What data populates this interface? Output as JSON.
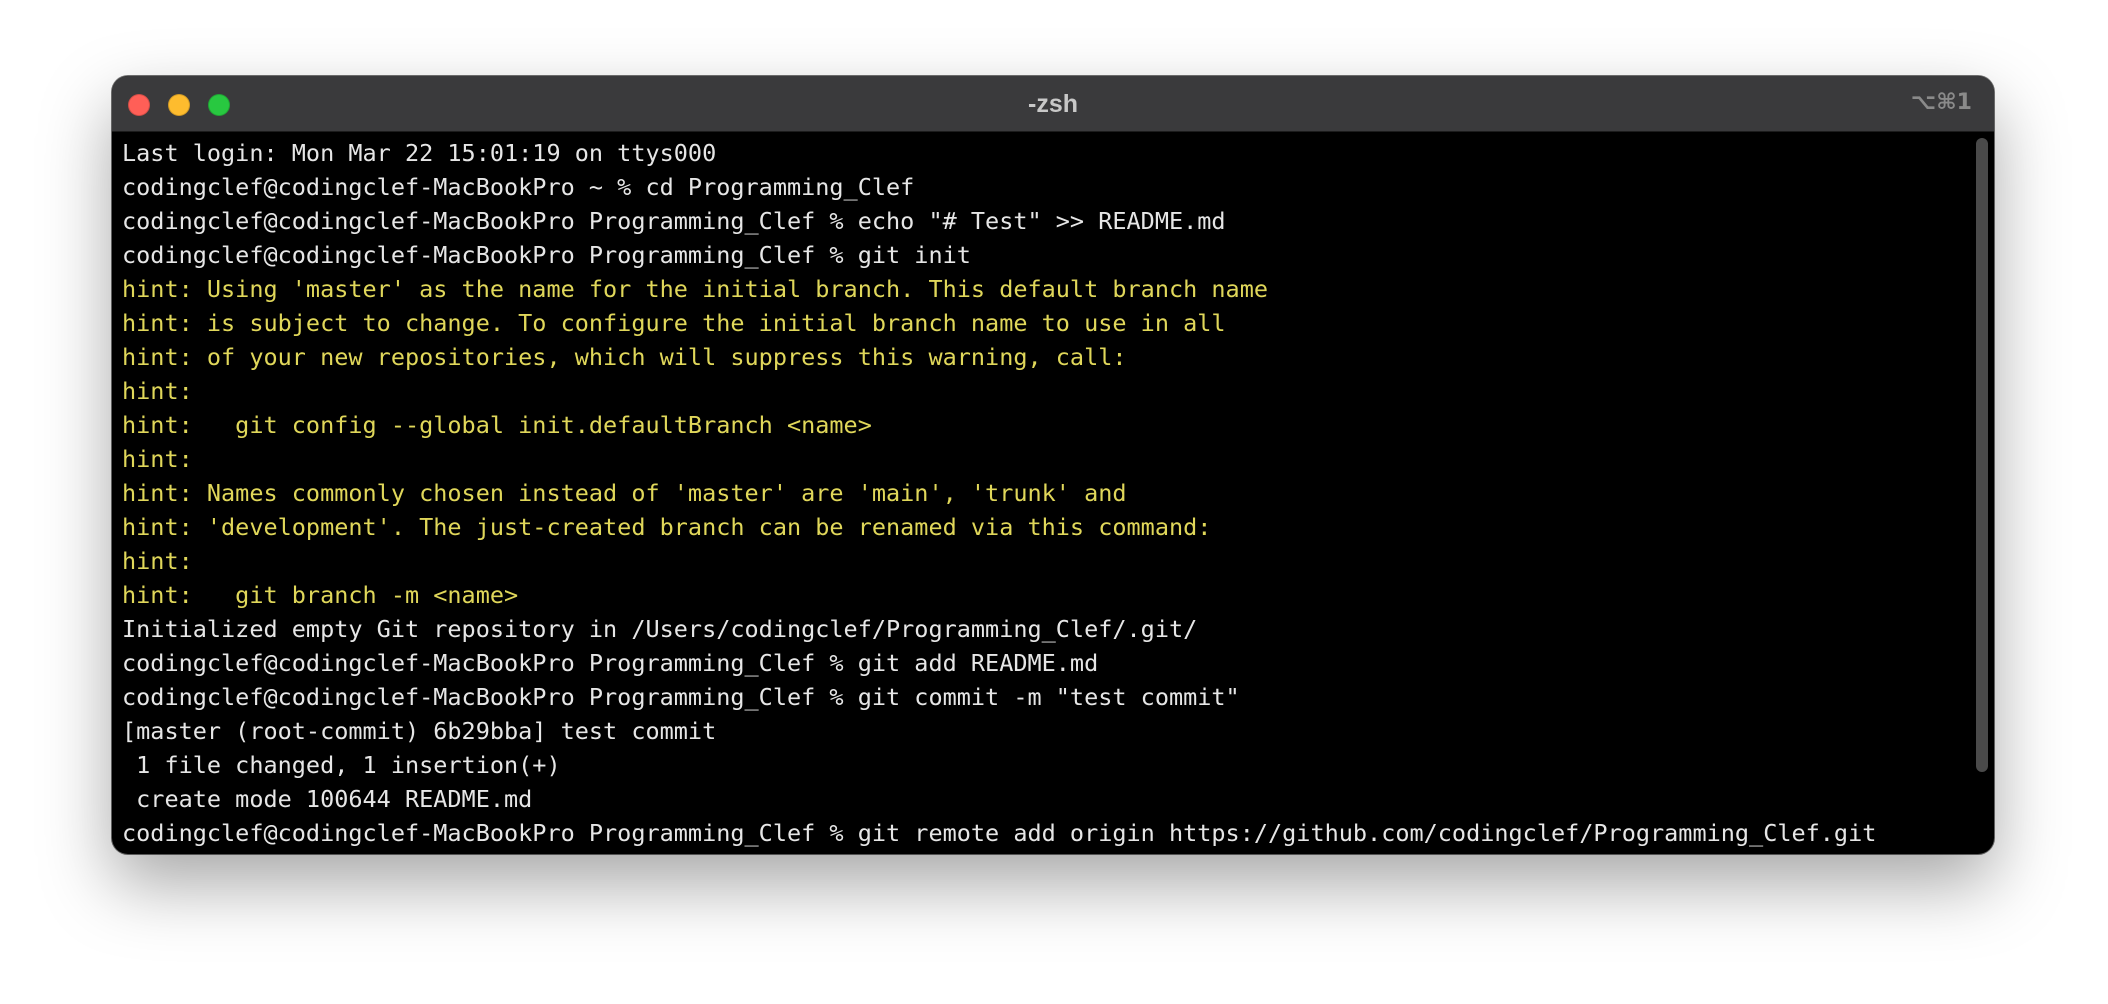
{
  "window": {
    "title": "-zsh",
    "shortcut": "⌥⌘1"
  },
  "terminal": {
    "lines": [
      {
        "text": "Last login: Mon Mar 22 15:01:19 on ttys000",
        "style": "normal"
      },
      {
        "text": "codingclef@codingclef-MacBookPro ~ % cd Programming_Clef",
        "style": "normal"
      },
      {
        "text": "codingclef@codingclef-MacBookPro Programming_Clef % echo \"# Test\" >> README.md",
        "style": "normal"
      },
      {
        "text": "codingclef@codingclef-MacBookPro Programming_Clef % git init",
        "style": "normal"
      },
      {
        "text": "hint: Using 'master' as the name for the initial branch. This default branch name",
        "style": "hint"
      },
      {
        "text": "hint: is subject to change. To configure the initial branch name to use in all",
        "style": "hint"
      },
      {
        "text": "hint: of your new repositories, which will suppress this warning, call:",
        "style": "hint"
      },
      {
        "text": "hint:",
        "style": "hint"
      },
      {
        "text": "hint:   git config --global init.defaultBranch <name>",
        "style": "hint"
      },
      {
        "text": "hint:",
        "style": "hint"
      },
      {
        "text": "hint: Names commonly chosen instead of 'master' are 'main', 'trunk' and",
        "style": "hint"
      },
      {
        "text": "hint: 'development'. The just-created branch can be renamed via this command:",
        "style": "hint"
      },
      {
        "text": "hint:",
        "style": "hint"
      },
      {
        "text": "hint:   git branch -m <name>",
        "style": "hint"
      },
      {
        "text": "Initialized empty Git repository in /Users/codingclef/Programming_Clef/.git/",
        "style": "normal"
      },
      {
        "text": "codingclef@codingclef-MacBookPro Programming_Clef % git add README.md",
        "style": "normal"
      },
      {
        "text": "codingclef@codingclef-MacBookPro Programming_Clef % git commit -m \"test commit\"",
        "style": "normal"
      },
      {
        "text": "[master (root-commit) 6b29bba] test commit",
        "style": "normal"
      },
      {
        "text": " 1 file changed, 1 insertion(+)",
        "style": "normal"
      },
      {
        "text": " create mode 100644 README.md",
        "style": "normal"
      },
      {
        "text": "codingclef@codingclef-MacBookPro Programming_Clef % git remote add origin https://github.com/codingclef/Programming_Clef.git",
        "style": "normal"
      }
    ]
  },
  "colors": {
    "window_bg": "#000000",
    "titlebar_bg": "#3a3a3c",
    "text_normal": "#e6e6e6",
    "text_hint": "#e0d75a",
    "close": "#ff5f57",
    "minimize": "#febc2e",
    "zoom": "#28c840"
  }
}
